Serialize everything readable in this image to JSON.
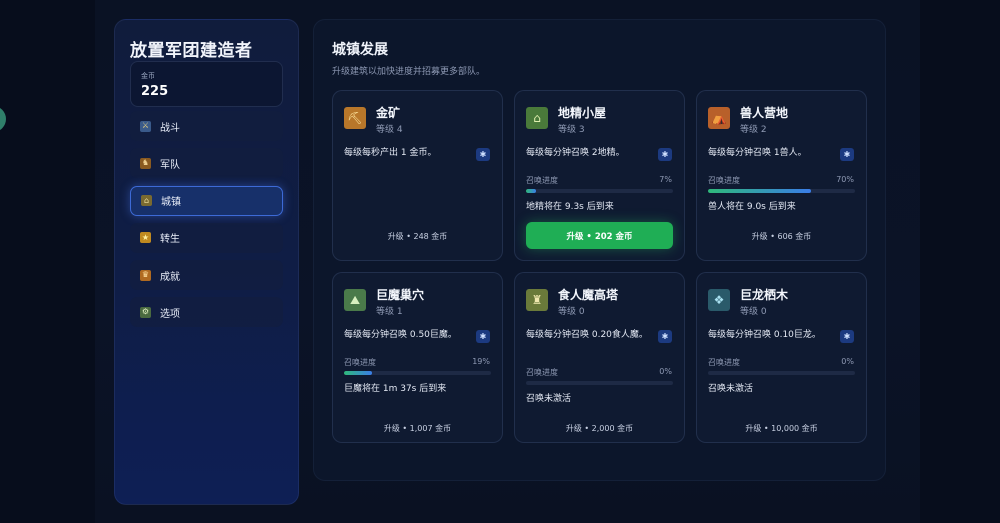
{
  "app": {
    "title": "放置军团建造者"
  },
  "gold": {
    "label": "金币",
    "value": "225"
  },
  "nav": [
    {
      "label": "战斗",
      "icon": "crossed-swords-icon",
      "color": "#3a5a8a"
    },
    {
      "label": "军队",
      "icon": "soldier-icon",
      "color": "#8a5a20"
    },
    {
      "label": "城镇",
      "icon": "town-icon",
      "color": "#7a6a30",
      "active": true
    },
    {
      "label": "转生",
      "icon": "star-icon",
      "color": "#c08a20"
    },
    {
      "label": "成就",
      "icon": "trophy-icon",
      "color": "#b06a20"
    },
    {
      "label": "选项",
      "icon": "options-icon",
      "color": "#4a6a40"
    }
  ],
  "main": {
    "title": "城镇发展",
    "subtitle": "升级建筑以加快进度并招募更多部队。"
  },
  "buildings": [
    {
      "name": "金矿",
      "level": "等级 4",
      "icon": "gold-mine-icon",
      "icon_color": "#b8772a",
      "desc": "每级每秒产出 1 金币。",
      "upgrade": "升级 • 248 金币"
    },
    {
      "name": "地精小屋",
      "level": "等级 3",
      "icon": "goblin-hut-icon",
      "icon_color": "#4a7a3a",
      "desc": "每级每分钟召唤 2地精。",
      "progress_label": "召唤进度",
      "progress_pct": "7%",
      "progress": 0.07,
      "status": "地精将在 9.3s 后到来",
      "upgrade": "升级 • 202 金币",
      "upgrade_highlight": true
    },
    {
      "name": "兽人营地",
      "level": "等级 2",
      "icon": "orc-camp-icon",
      "icon_color": "#b8602a",
      "desc": "每级每分钟召唤 1兽人。",
      "progress_label": "召唤进度",
      "progress_pct": "70%",
      "progress": 0.7,
      "status": "兽人将在 9.0s 后到来",
      "upgrade": "升级 • 606 金币"
    },
    {
      "name": "巨魔巢穴",
      "level": "等级 1",
      "icon": "troll-den-icon",
      "icon_color": "#4a7a4a",
      "desc": "每级每分钟召唤 0.50巨魔。",
      "progress_label": "召唤进度",
      "progress_pct": "19%",
      "progress": 0.19,
      "status": "巨魔将在 1m 37s 后到来",
      "upgrade": "升级 • 1,007 金币"
    },
    {
      "name": "食人魔高塔",
      "level": "等级 0",
      "icon": "ogre-tower-icon",
      "icon_color": "#6a7a3a",
      "desc": "每级每分钟召唤 0.20食人魔。",
      "progress_label": "召唤进度",
      "progress_pct": "0%",
      "progress": 0,
      "status": "召唤未激活",
      "upgrade": "升级 • 2,000 金币"
    },
    {
      "name": "巨龙栖木",
      "level": "等级 0",
      "icon": "dragon-roost-icon",
      "icon_color": "#2a5a6a",
      "desc": "每级每分钟召唤 0.10巨龙。",
      "progress_label": "召唤进度",
      "progress_pct": "0%",
      "progress": 0,
      "status": "召唤未激活",
      "upgrade": "升级 • 10,000 金币"
    }
  ]
}
